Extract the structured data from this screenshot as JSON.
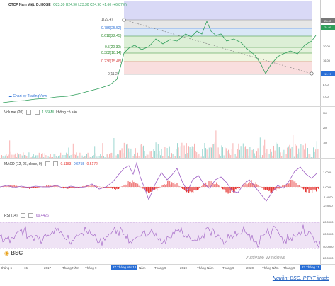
{
  "header": {
    "symbol": "CTCP Nam Việt, D, HOSE",
    "ohlc": "O23.30  H24.90  L23.30  C24.90  +1.60 (+6.87%)"
  },
  "fib_levels": [
    {
      "label": "1(29.4)",
      "color": "#555555"
    },
    {
      "label": "0.786(25.52)",
      "color": "#2a6fd6"
    },
    {
      "label": "0.618(22.45)",
      "color": "#2e8b2e"
    },
    {
      "label": "0.5(20.30)",
      "color": "#2e8b2e"
    },
    {
      "label": "0.382(18.14)",
      "color": "#2e8b2e"
    },
    {
      "label": "0.236(15.48)",
      "color": "#d64545"
    },
    {
      "label": "0(11.2)",
      "color": "#555555"
    }
  ],
  "price_axis": [
    "28.43",
    "24.90",
    "20.00",
    "16.00",
    "11.17",
    "8.00",
    "4.00"
  ],
  "price_tags": {
    "top": "28.43",
    "mid": "24.90",
    "low": "11.17"
  },
  "volume": {
    "label": "Volume (20)",
    "value": "1.566M",
    "note": "không có sẵn",
    "axis": [
      "3M",
      "2M",
      "1M"
    ]
  },
  "macd": {
    "label": "MACD (12, 26, close, 9)",
    "v1": "0.1183",
    "v2": "0.6755",
    "v3": "0.5172",
    "axis": [
      "1.0000",
      "0.0000",
      "-1.0000",
      "-2.0000"
    ]
  },
  "rsi": {
    "label": "RSI (14)",
    "value": "69.4426",
    "axis": [
      "80.0000",
      "60.0000",
      "40.0000",
      "20.0000"
    ]
  },
  "watermark": "Chart by TradingView",
  "brand": "BSC",
  "activate": "Activate Windows",
  "x_axis": [
    "tháng 6",
    "15",
    "2017",
    "Tháng Năm",
    "Tháng 9",
    "Năm",
    "Tháng 9",
    "2019",
    "Tháng Năm",
    "Tháng 9",
    "2020",
    "Tháng Năm",
    "Tháng 9"
  ],
  "x_highlight_left": "27 Tháng Mư 18",
  "x_highlight_right": "23 Tháng 11",
  "source": "Nguồn: BSC, PTKT itrade",
  "colors": {
    "up": "#26a69a",
    "down": "#ef5350",
    "macd": "#9c5bc2",
    "signal": "#e53935",
    "rsi": "#9c5bc2"
  }
}
